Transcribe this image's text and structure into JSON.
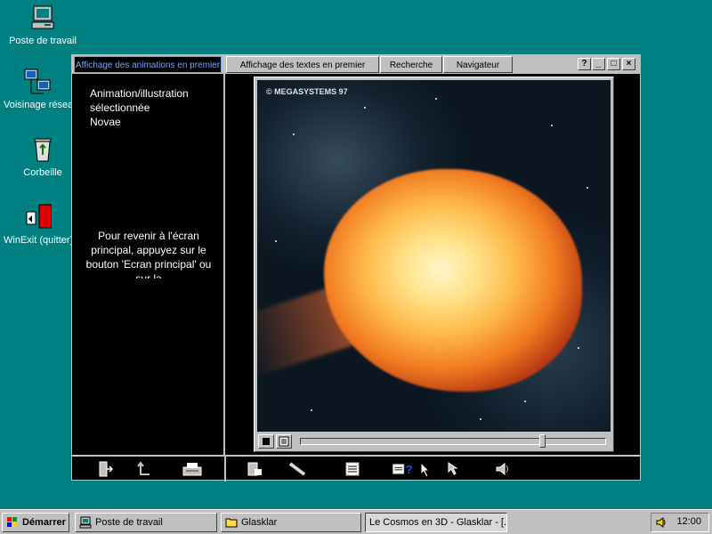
{
  "desktop": {
    "icons": [
      {
        "label": "Poste de travail",
        "icon": "computer-icon"
      },
      {
        "label": "Voisinage réseau",
        "icon": "network-icon"
      },
      {
        "label": "Corbeille",
        "icon": "recycle-bin-icon"
      },
      {
        "label": "WinExit (quitter)",
        "icon": "winexit-icon"
      }
    ]
  },
  "app": {
    "tabs": [
      {
        "label": "Affichage des animations en premier",
        "active": true
      },
      {
        "label": "Affichage des textes en premier",
        "active": false
      },
      {
        "label": "Recherche",
        "active": false
      },
      {
        "label": "Navigateur",
        "active": false
      }
    ],
    "window_buttons": [
      "?",
      "_",
      "□",
      "×"
    ],
    "selection": {
      "line1": "Animation/illustration",
      "line2": "sélectionnée",
      "line3": "Novae"
    },
    "help_text": "Pour revenir à l'écran principal, appuyez sur le bouton 'Ecran principal' ou sur la",
    "image": {
      "watermark": "© MEGASYSTEMS 97",
      "subject": "nova-explosion"
    },
    "player": {
      "progress": 0.8
    },
    "toolbar_left": [
      "exit-icon",
      "back-icon",
      "print-icon"
    ],
    "toolbar_right": [
      "notebook-icon",
      "telescope-icon",
      "text-icon",
      "help-icon",
      "pointer-icon",
      "sound-icon"
    ]
  },
  "taskbar": {
    "start_label": "Démarrer",
    "buttons": [
      {
        "label": "Poste de travail",
        "pressed": false
      },
      {
        "label": "Glasklar",
        "pressed": false
      },
      {
        "label": "Le Cosmos en 3D - Glasklar - [...",
        "pressed": true
      }
    ],
    "clock": "12:00"
  },
  "colors": {
    "desktop": "#008080",
    "chrome": "#c0c0c0",
    "active_tab_text": "#6fa8ff"
  }
}
